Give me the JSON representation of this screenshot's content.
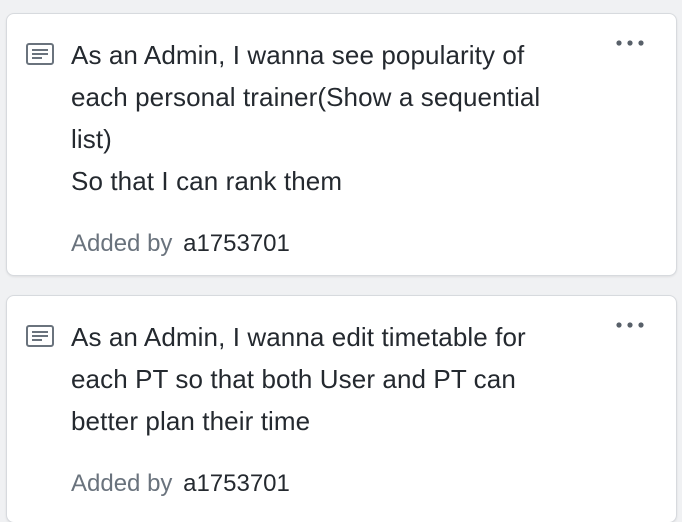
{
  "cards": [
    {
      "lines": [
        "As an Admin, I wanna see popularity of",
        "each personal trainer(Show a sequential",
        "list)",
        "So that I can rank them"
      ],
      "added_by_label": "Added by",
      "author": "a1753701",
      "note_icon": "note-icon",
      "menu_icon": "more-horizontal-icon"
    },
    {
      "lines": [
        "As an Admin, I wanna edit timetable for",
        "each PT so that both User and PT can",
        "better plan their time"
      ],
      "added_by_label": "Added by",
      "author": "a1753701",
      "note_icon": "note-icon",
      "menu_icon": "more-horizontal-icon"
    }
  ]
}
